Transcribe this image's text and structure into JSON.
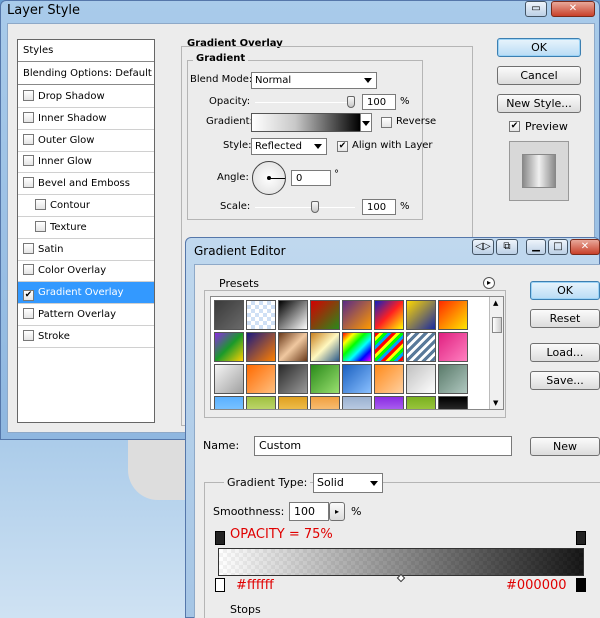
{
  "layer_style": {
    "title": "Layer Style",
    "styles_panel": {
      "header": "Styles",
      "blending": "Blending Options: Default",
      "items": [
        {
          "label": "Drop Shadow",
          "checked": false,
          "indent": false
        },
        {
          "label": "Inner Shadow",
          "checked": false,
          "indent": false
        },
        {
          "label": "Outer Glow",
          "checked": false,
          "indent": false
        },
        {
          "label": "Inner Glow",
          "checked": false,
          "indent": false
        },
        {
          "label": "Bevel and Emboss",
          "checked": false,
          "indent": false
        },
        {
          "label": "Contour",
          "checked": false,
          "indent": true
        },
        {
          "label": "Texture",
          "checked": false,
          "indent": true
        },
        {
          "label": "Satin",
          "checked": false,
          "indent": false
        },
        {
          "label": "Color Overlay",
          "checked": false,
          "indent": false
        },
        {
          "label": "Gradient Overlay",
          "checked": true,
          "indent": false,
          "selected": true
        },
        {
          "label": "Pattern Overlay",
          "checked": false,
          "indent": false
        },
        {
          "label": "Stroke",
          "checked": false,
          "indent": false
        }
      ]
    },
    "gradient_overlay": {
      "section_title": "Gradient Overlay",
      "group_title": "Gradient",
      "blend_mode_label": "Blend Mode:",
      "blend_mode_value": "Normal",
      "opacity_label": "Opacity:",
      "opacity_value": "100",
      "opacity_unit": "%",
      "opacity_level": 1.0,
      "gradient_label": "Gradient:",
      "reverse_label": "Reverse",
      "reverse_checked": false,
      "style_label": "Style:",
      "style_value": "Reflected",
      "align_label": "Align with Layer",
      "align_checked": true,
      "angle_label": "Angle:",
      "angle_value": "0",
      "angle_unit": "°",
      "scale_label": "Scale:",
      "scale_value": "100",
      "scale_unit": "%",
      "scale_level": 0.5
    },
    "buttons": {
      "ok": "OK",
      "cancel": "Cancel",
      "new_style": "New Style...",
      "preview_label": "Preview",
      "preview_checked": true
    }
  },
  "gradient_editor": {
    "title": "Gradient Editor",
    "presets_label": "Presets",
    "buttons": {
      "ok": "OK",
      "reset": "Reset",
      "load": "Load...",
      "save": "Save...",
      "new": "New"
    },
    "name_label": "Name:",
    "name_value": "Custom",
    "gradient_type_label": "Gradient Type:",
    "gradient_type_value": "Solid",
    "smoothness_label": "Smoothness:",
    "smoothness_value": "100",
    "smoothness_unit": "%",
    "opacity_annotation": "OPACITY = 75%",
    "left_color_annotation": "#ffffff",
    "right_color_annotation": "#000000",
    "stops_label": "Stops",
    "preset_swatches": [
      [
        "linear-gradient(135deg,#3a3a3a,#6a6a6a)",
        "repeating-conic-gradient(#cfe0f5 0 25%,#fff 0 50%) 0 0/8px 8px",
        "linear-gradient(135deg,#000,#fff)",
        "linear-gradient(135deg,#d40000,#2a8a1a)",
        "linear-gradient(135deg,#5a2a86,#ff9a00)",
        "linear-gradient(135deg,#1020c0,#ff2020,#ffff00)",
        "linear-gradient(135deg,#ffd800,#1a2aa0)",
        "linear-gradient(135deg,#ff2a00,#ffe600)"
      ],
      [
        "linear-gradient(135deg,#8a2be2,#1a9a2a,#ffd000)",
        "linear-gradient(135deg,#1a1a80,#ff8000)",
        "linear-gradient(135deg,#6a3a1a,#f0c8a0,#6a3a1a)",
        "linear-gradient(135deg,#c88020,#fff8c0,#2a5a8a)",
        "linear-gradient(135deg,#ff0000,#ffff00,#00ff00,#00ffff,#0000ff,#ff00ff)",
        "repeating-linear-gradient(135deg,#ff0000 0 3px,#ffff00 3px 6px,#00ff00 6px 9px,#00a0ff 9px 12px)",
        "repeating-linear-gradient(135deg,#5a7a9a 0 3px,#fff 3px 6px)",
        "linear-gradient(135deg,#e02080,#ff80c0)"
      ],
      [
        "linear-gradient(135deg,#f5f5f5,#a0a0a0)",
        "linear-gradient(135deg,#ff6a00,#ffc080)",
        "linear-gradient(135deg,#2a2a2a,#9a9a9a)",
        "linear-gradient(135deg,#2a8a1a,#9ae070)",
        "linear-gradient(135deg,#1a60c0,#8ac0ff)",
        "linear-gradient(135deg,#ff8a1a,#ffd0a0)",
        "linear-gradient(135deg,#c0c0c0,#ffffff)",
        "linear-gradient(135deg,#5a7a6a,#b0c8c0)"
      ],
      [
        "linear-gradient(180deg,#5ab0ff,#a0d8ff)",
        "linear-gradient(180deg,#a0c040,#e0f0a0)",
        "linear-gradient(180deg,#e0a020,#ffe080)",
        "linear-gradient(180deg,#f0a040,#ffe0b0)",
        "linear-gradient(180deg,#9ab0d0,#e0ecf8)",
        "linear-gradient(180deg,#8a2be2,#d0a0ff)",
        "linear-gradient(180deg,#7ab020,#c0e060)",
        "linear-gradient(180deg,#000,#5a5a5a)"
      ]
    ]
  }
}
